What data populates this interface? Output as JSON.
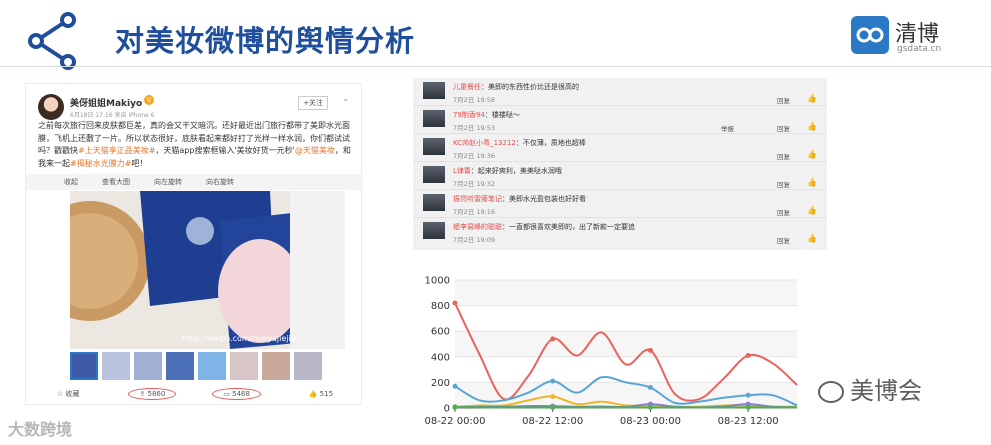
{
  "header": {
    "title": "对美妆微博的舆情分析",
    "logo_name": "清博",
    "logo_site": "gsdata.cn"
  },
  "post": {
    "username": "美伢姐姐Makiyo",
    "meta": "6月18日 17:16 来自 iPhone 6",
    "follow_label": "+关注",
    "body_a": "之前每次旅行回来皮肤都巨差，真的会又干又暗沉。还好最近出门旅行都带了美即水光面膜，飞机上还敷了一片。所以状态很好，底肤看起来都好打了光样一样水润，你们都试试吗？戳戳快",
    "body_link1": "#上天猫享正品美妆#",
    "body_b": "，天猫app搜索框输入'美妆好货一元秒'",
    "body_link2": "@天猫美妆",
    "body_c": "，和我来一起",
    "body_link3": "#揭秘水光膜力#",
    "body_d": "吧！",
    "toolbar": [
      "收起",
      "查看大图",
      "向左旋转",
      "向右旋转"
    ],
    "watermark": "http://weibo.com/meiyajiejie",
    "actions": {
      "fav": "收藏",
      "repost": "5860",
      "comment": "5468",
      "like": "515"
    }
  },
  "comments": [
    {
      "name": "儿童餐任",
      "text": "：美即的东西性价比还是很高的",
      "time": "7月2日 19:58",
      "report": "",
      "reply": "回复"
    },
    {
      "name": "79制香94",
      "text": "：楼楼哒～",
      "time": "7月2日 19:53",
      "report": "举报",
      "reply": "回复"
    },
    {
      "name": "KC帅赵小粤_13212",
      "text": "：不仅薄，质地也超棒",
      "time": "7月2日 19:36",
      "report": "",
      "reply": "回复"
    },
    {
      "name": "L律箐",
      "text": "：起来好爽利，美美哒水润哦",
      "time": "7月2日 19:32",
      "report": "",
      "reply": "回复"
    },
    {
      "name": "振然听雷藤笔记",
      "text": "：美即水光盈包装也好好看",
      "time": "7月2日 19:16",
      "report": "",
      "reply": "回复"
    },
    {
      "name": "蟋李易峰的聪聪",
      "text": "：一直都很喜欢美即的，出了新款一定要追",
      "time": "7月2日 19:09",
      "report": "",
      "reply": "回复"
    }
  ],
  "chart_data": {
    "type": "line",
    "x_ticks": [
      "08-22 00:00",
      "08-22 12:00",
      "08-23 00:00",
      "08-23 12:00"
    ],
    "y_ticks": [
      "0",
      "200",
      "400",
      "600",
      "800",
      "1000"
    ],
    "ylim": [
      0,
      1000
    ],
    "x": [
      0,
      3,
      6,
      9,
      12,
      15,
      18,
      21,
      24,
      27,
      30,
      33,
      36,
      39,
      42
    ],
    "series": [
      {
        "color": "#e8635b",
        "values": [
          820,
          420,
          70,
          250,
          540,
          410,
          590,
          340,
          450,
          110,
          70,
          230,
          410,
          350,
          180
        ]
      },
      {
        "color": "#58a6d8",
        "values": [
          170,
          60,
          60,
          120,
          210,
          120,
          240,
          200,
          160,
          40,
          50,
          80,
          100,
          100,
          20
        ]
      },
      {
        "color": "#f2b527",
        "values": [
          10,
          20,
          20,
          60,
          90,
          30,
          50,
          20,
          20,
          10,
          10,
          20,
          20,
          10,
          10
        ]
      },
      {
        "color": "#8a7ad0",
        "values": [
          5,
          10,
          10,
          15,
          15,
          10,
          12,
          8,
          30,
          10,
          5,
          12,
          30,
          10,
          5
        ]
      },
      {
        "color": "#4caf50",
        "values": [
          8,
          5,
          5,
          5,
          5,
          5,
          5,
          5,
          5,
          5,
          5,
          5,
          5,
          5,
          5
        ]
      }
    ]
  },
  "watermarks": {
    "left": "大数跨境",
    "right": "美博会"
  }
}
